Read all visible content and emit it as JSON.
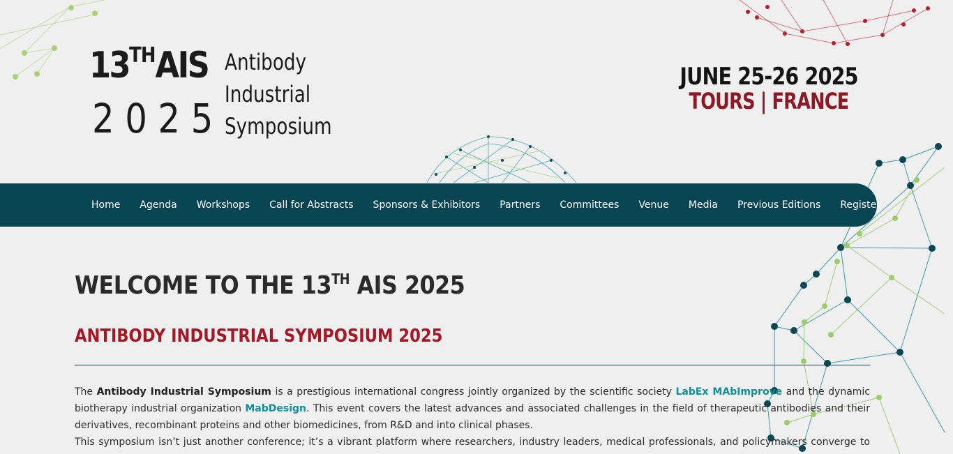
{
  "header": {
    "logo": {
      "number": "13",
      "number_sup": "TH",
      "acronym": "AIS",
      "year": "2025",
      "words": [
        "Antibody",
        "Industrial",
        "Symposium"
      ]
    },
    "dates": "JUNE 25-26 2025",
    "location": "TOURS | FRANCE"
  },
  "nav": {
    "items": [
      {
        "label": "Home"
      },
      {
        "label": "Agenda"
      },
      {
        "label": "Workshops"
      },
      {
        "label": "Call for Abstracts"
      },
      {
        "label": "Sponsors & Exhibitors"
      },
      {
        "label": "Partners"
      },
      {
        "label": "Committees"
      },
      {
        "label": "Venue"
      },
      {
        "label": "Media"
      },
      {
        "label": "Previous Editions"
      },
      {
        "label": "Register"
      }
    ]
  },
  "main": {
    "welcome_pre": "WELCOME TO THE 13",
    "welcome_sup": "TH",
    "welcome_post": " AIS 2025",
    "subtitle": "ANTIBODY INDUSTRIAL SYMPOSIUM 2025",
    "p1": {
      "t1": "The ",
      "b1": "Antibody Industrial Symposium",
      "t2": " is a prestigious international congress jointly organized by the scientific society ",
      "link1": "LabEx MAbImprove",
      "t3": " and the dynamic biotherapy industrial organization ",
      "link2": "MabDesign",
      "t4": ". This event covers the latest advances and associated challenges in the field of therapeutic antibodies and their derivatives, recombinant proteins and other biomedicines, from R&D and into clinical phases."
    },
    "p2": "This symposium isn’t just another conference; it’s a vibrant platform where researchers, industry leaders, medical professionals, and policymakers converge to explore the"
  },
  "colors": {
    "nav_bg": "#084552",
    "accent_red": "#a51724",
    "link_teal": "#0e8f96",
    "background": "#efefef"
  }
}
